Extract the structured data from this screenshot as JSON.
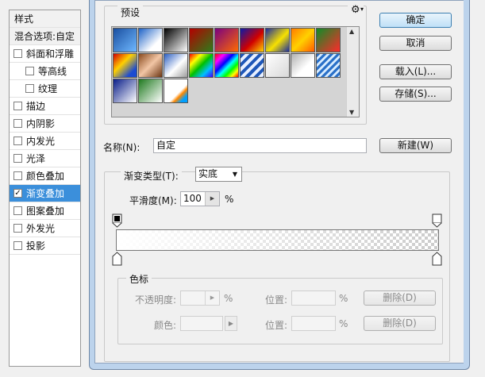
{
  "styles_panel": {
    "header": "样式",
    "blend_options": "混合选项:自定",
    "items": [
      {
        "label": "斜面和浮雕",
        "checked": false,
        "sub": false,
        "selected": false
      },
      {
        "label": "等高线",
        "checked": false,
        "sub": true,
        "selected": false
      },
      {
        "label": "纹理",
        "checked": false,
        "sub": true,
        "selected": false
      },
      {
        "label": "描边",
        "checked": false,
        "sub": false,
        "selected": false
      },
      {
        "label": "内阴影",
        "checked": false,
        "sub": false,
        "selected": false
      },
      {
        "label": "内发光",
        "checked": false,
        "sub": false,
        "selected": false
      },
      {
        "label": "光泽",
        "checked": false,
        "sub": false,
        "selected": false
      },
      {
        "label": "颜色叠加",
        "checked": false,
        "sub": false,
        "selected": false
      },
      {
        "label": "渐变叠加",
        "checked": true,
        "sub": false,
        "selected": true
      },
      {
        "label": "图案叠加",
        "checked": false,
        "sub": false,
        "selected": false
      },
      {
        "label": "外发光",
        "checked": false,
        "sub": false,
        "selected": false
      },
      {
        "label": "投影",
        "checked": false,
        "sub": false,
        "selected": false
      }
    ]
  },
  "dialog": {
    "presets_label": "预设",
    "gear_glyph": "⚙",
    "swatches": [
      {
        "bg": "linear-gradient(135deg,#1a4fa0,#6fb8ff)"
      },
      {
        "bg": "linear-gradient(135deg,#1d62c7,#ffffff 70%)"
      },
      {
        "bg": "linear-gradient(135deg,#000000,#ffffff)"
      },
      {
        "bg": "linear-gradient(135deg,#b40000,#2d7d1a)"
      },
      {
        "bg": "linear-gradient(135deg,#7a0080,#ff6a00)"
      },
      {
        "bg": "linear-gradient(135deg,#0b1aa8,#d00000 55%,#ffd400)"
      },
      {
        "bg": "linear-gradient(135deg,#1c2d9e,#f7e100 55%,#1c2d9e)"
      },
      {
        "bg": "linear-gradient(135deg,#ff7a00,#ffd100 50%,#ff5a00)"
      },
      {
        "bg": "linear-gradient(135deg,#0f8c27,#ff2a2a)"
      },
      {
        "bg": "linear-gradient(135deg,#d40000,#ffd000 40%,#1c4bd1 80%)"
      },
      {
        "bg": "linear-gradient(135deg,#8a4b1f,#f2c6a5 50%,#6b3513)"
      },
      {
        "bg": "linear-gradient(135deg,#2b5fc2,#ffffff 55%,#9d9d9d)"
      },
      {
        "bg": "linear-gradient(135deg,#ff0000,#ffff00,#00c000,#00c0ff,#4000ff)"
      },
      {
        "bg": "linear-gradient(135deg,#ff0000,#ff00ff 20%,#0000ff 40%,#00ffff 55%,#00ff00 70%,#ffff00 85%,#ff0000)"
      },
      {
        "bg": "repeating-linear-gradient(135deg,#1f57b8 0 4px,#e8f0ff 4px 8px)"
      },
      {
        "bg": "linear-gradient(135deg,#ffffff,#d8d8d8)"
      },
      {
        "bg": "linear-gradient(135deg,#b0b0b0,#ffffff 60%)"
      },
      {
        "bg": "repeating-linear-gradient(135deg,#2a70c8 0 3px,#d8ecff 3px 6px)"
      },
      {
        "bg": "linear-gradient(135deg,#0a1e8a,#ffffff)"
      },
      {
        "bg": "linear-gradient(135deg,#1f7a1f,#ffffff)"
      },
      {
        "bg": "linear-gradient(135deg,#ffffff,#ffffff 60%,#ff8800 70%,#00a0ff 85%)"
      }
    ],
    "name_label": "名称(N):",
    "name_value": "自定",
    "buttons": {
      "ok": "确定",
      "cancel": "取消",
      "load": "载入(L)...",
      "save": "存储(S)...",
      "new": "新建(W)"
    },
    "gradient_type_label": "渐变类型(T):",
    "gradient_type_value": "实底",
    "smoothness_label": "平滑度(M):",
    "smoothness_value": "100",
    "smoothness_unit": "%",
    "color_stops": {
      "title": "色标",
      "opacity_label": "不透明度:",
      "opacity_unit": "%",
      "location_label": "位置:",
      "location_unit": "%",
      "delete_label": "删除(D)",
      "color_label": "颜色:"
    }
  }
}
